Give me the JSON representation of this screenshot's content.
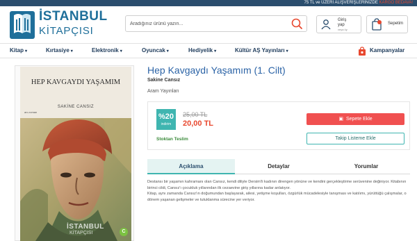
{
  "topbar": {
    "text_main": "75 TL ve ÜZERİ ALIŞVERİŞLERİNİZDE",
    "text_accent": "KARGO BEDAVA!"
  },
  "logo": {
    "line1": "İSTANBUL",
    "line2": "KİTAPÇISI"
  },
  "search": {
    "placeholder": "Aradığınız ürünü yazın..."
  },
  "account": {
    "line1": "Giriş",
    "line2": "yap",
    "line3": "veya üy"
  },
  "cart": {
    "label": "Sepetim"
  },
  "nav": {
    "items": [
      "Kitap",
      "Kırtasiye",
      "Elektronik",
      "Oyuncak",
      "Hediyelik",
      "Kültür AŞ Yayınları"
    ],
    "campaign": "Kampanyalar"
  },
  "cover": {
    "title": "HEP KAVGAYDI YAŞAMIM",
    "author": "SAKİNE CANSIZ",
    "tag": "anı-roman",
    "watermark_line1": "İSTANBUL",
    "watermark_line2": "KİTAPÇISI",
    "watermark_badge": "C"
  },
  "product": {
    "title": "Hep Kavgaydı Yaşamım (1. Cilt)",
    "author": "Sakine Cansız",
    "publisher": "Aram Yayınları",
    "discount_percent": "%20",
    "discount_label": "indirim",
    "old_price": "25,00 TL",
    "new_price": "20,00 TL",
    "stock": "Stoktan Teslim",
    "add_to_cart": "Sepete Ekle",
    "wishlist": "Takip Listeme Ekle"
  },
  "tabs": [
    "Açıklama",
    "Detaylar",
    "Yorumlar"
  ],
  "description": {
    "p1": "Destansı bir yaşamın kahramanı olan Cansız, kendi diliyle Dersim'li kadının direngen yönüne ve kendini gerçekleştirme serüvenine değiniyor. Kitabının birinci cildi, Cansız'ı çocukluk yıllarından ilk cezaevine giriş yıllarına kadar anlatıyor.",
    "p2": "Kitap, aynı zamanda Cansız'ın doğumundan başlayarak, ailesi, yetişme koşulları, özgürlük mücadelesiyle tanışması ve katılımı, yürüttüğü çalışmalar, o dönem yaşanan gelişmeler ve tutuklanma sürecine yer veriyor."
  },
  "colors": {
    "topbar": "#2b4e6e",
    "brand": "#1f6f9a",
    "title_blue": "#2b63a6",
    "price_red": "#e8482f",
    "cart_button": "#f05050",
    "teal": "#3fb5b0"
  }
}
